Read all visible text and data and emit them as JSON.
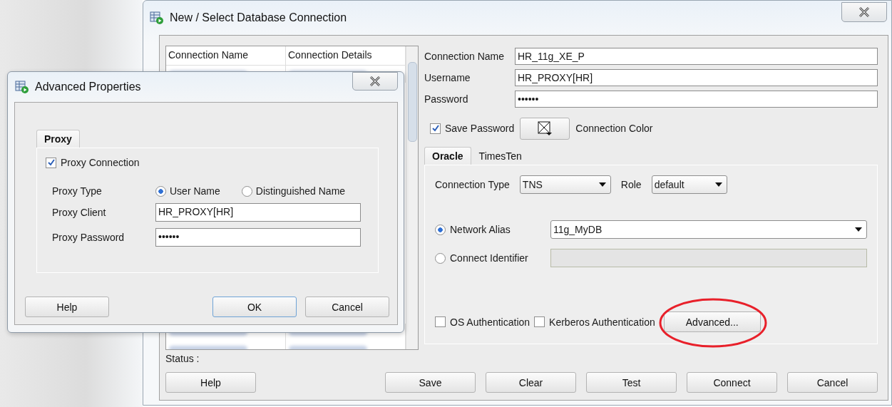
{
  "main_window": {
    "title": "New / Select Database Connection"
  },
  "connections_table": {
    "columns": [
      "Connection Name",
      "Connection Details"
    ],
    "rows": [
      {
        "redacted": true
      },
      {
        "redacted": true
      },
      {
        "redacted": true
      }
    ]
  },
  "status": {
    "label": "Status :"
  },
  "form": {
    "fields": [
      {
        "label": "Connection Name",
        "value": "HR_11g_XE_P"
      },
      {
        "label": "Username",
        "value": "HR_PROXY[HR]"
      },
      {
        "label": "Password",
        "value": "••••••"
      }
    ],
    "save_password": {
      "label": "Save Password",
      "checked": true
    },
    "connection_color": {
      "label": "Connection Color"
    }
  },
  "tabs": [
    {
      "label": "Oracle",
      "selected": true
    },
    {
      "label": "TimesTen",
      "selected": false
    }
  ],
  "oracle": {
    "connection_type": {
      "label": "Connection Type",
      "value": "TNS"
    },
    "role": {
      "label": "Role",
      "value": "default"
    },
    "options": [
      {
        "label": "Network Alias",
        "selected": true,
        "kind": "dropdown",
        "value": "11g_MyDB"
      },
      {
        "label": "Connect Identifier",
        "selected": false,
        "kind": "text",
        "disabled": true
      }
    ],
    "auth": [
      {
        "label": "OS Authentication",
        "checked": false
      },
      {
        "label": "Kerberos Authentication",
        "checked": false
      }
    ],
    "advanced_button": {
      "label": "Advanced...",
      "circled": true
    }
  },
  "help_button": {
    "label": "Help"
  },
  "buttons": [
    {
      "label": "Save"
    },
    {
      "label": "Clear"
    },
    {
      "label": "Test"
    },
    {
      "label": "Connect"
    },
    {
      "label": "Cancel"
    }
  ],
  "advanced_dialog": {
    "title": "Advanced Properties",
    "tabs": [
      {
        "label": "Proxy",
        "selected": true
      }
    ],
    "proxy_connection": {
      "label": "Proxy Connection",
      "checked": true
    },
    "proxy_type": {
      "label": "Proxy Type",
      "options": [
        {
          "label": "User Name",
          "selected": true
        },
        {
          "label": "Distinguished Name",
          "selected": false
        }
      ]
    },
    "fields": [
      {
        "label": "Proxy Client",
        "value": "HR_PROXY[HR]"
      },
      {
        "label": "Proxy Password",
        "value": "••••••"
      }
    ],
    "buttons": [
      {
        "label": "Help",
        "kind": "help"
      },
      {
        "label": "OK",
        "kind": "default"
      },
      {
        "label": "Cancel",
        "kind": "normal"
      }
    ]
  }
}
